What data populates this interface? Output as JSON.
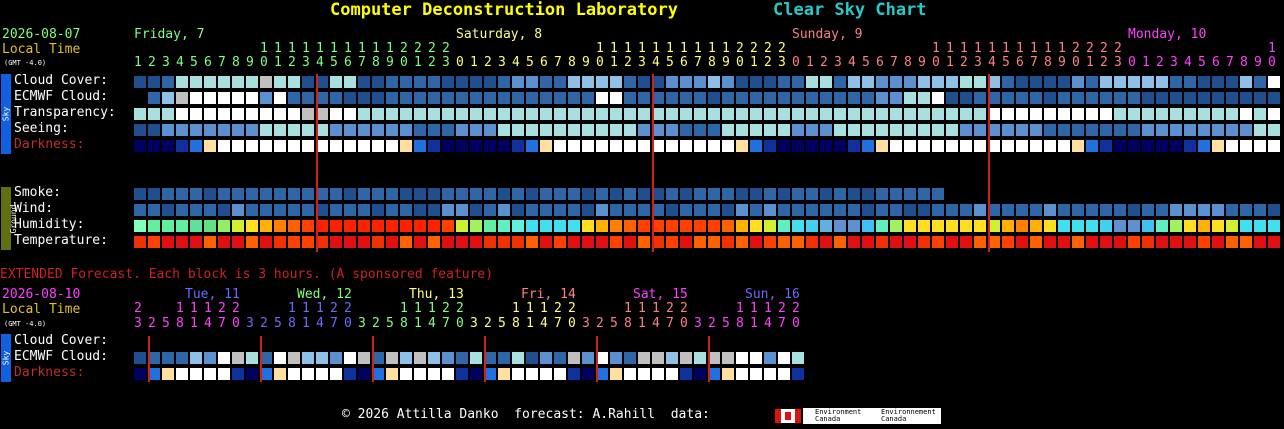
{
  "header": {
    "title": "Computer Deconstruction Laboratory",
    "subtitle": "Clear Sky Chart",
    "title_color": "#ffff00",
    "subtitle_color": "#22cccc"
  },
  "main": {
    "date": "2026-08-07",
    "local_time": "Local Time",
    "gmt": "(GMT -4.0)",
    "days": [
      {
        "label": "Friday, 7",
        "color": "#80ff80"
      },
      {
        "label": "Saturday, 8",
        "color": "#ffff80"
      },
      {
        "label": "Sunday, 9",
        "color": "#ff8080"
      },
      {
        "label": "Monday, 10",
        "color": "#ff40ff"
      }
    ],
    "sky_tab": "Sky",
    "ground_tab": "Ground",
    "rows": {
      "cloud": "Cloud Cover:",
      "ecmwf": "ECMWF Cloud:",
      "transp": "Transparency:",
      "seeing": "Seeing:",
      "dark": "Darkness:",
      "smoke": "Smoke:",
      "wind": "Wind:",
      "humidity": "Humidity:",
      "temp": "Temperature:"
    }
  },
  "extended": {
    "notice": "EXTENDED Forecast. Each block is 3 hours. (A sponsored feature)",
    "date": "2026-08-10",
    "local_time": "Local Time",
    "gmt": "(GMT -4.0)",
    "days": [
      {
        "label": "Tue, 11",
        "color": "#6a6aff"
      },
      {
        "label": "Wed, 12",
        "color": "#80ff80"
      },
      {
        "label": "Thu, 13",
        "color": "#ffff80"
      },
      {
        "label": "Fri, 14",
        "color": "#ff8080"
      },
      {
        "label": "Sat, 15",
        "color": "#ff40ff"
      },
      {
        "label": "Sun, 16",
        "color": "#6a6aff"
      }
    ],
    "sky_tab": "Sky",
    "rows": {
      "cloud": "Cloud Cover:",
      "ecmwf": "ECMWF Cloud:",
      "dark": "Darkness:"
    }
  },
  "footer": {
    "text": "© 2026 Attilla Danko  forecast: A.Rahill  data:",
    "env1": "Environment Canada",
    "env2": "Environnement Canada"
  }
}
